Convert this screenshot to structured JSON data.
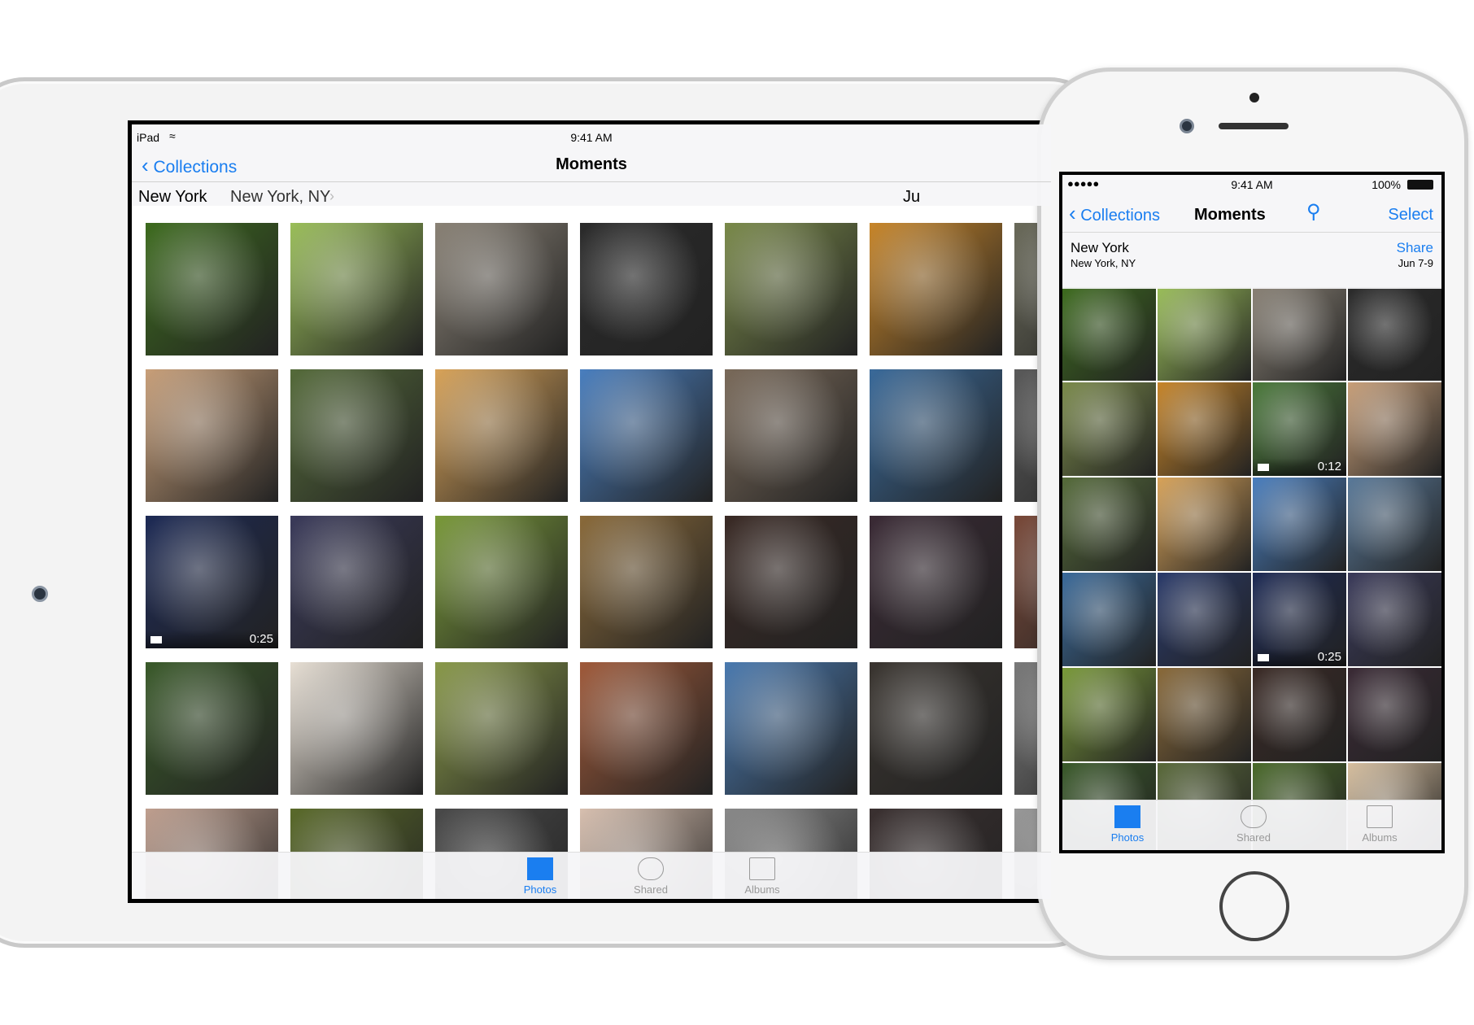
{
  "ipad": {
    "status": {
      "carrier": "iPad",
      "time": "9:41 AM"
    },
    "nav": {
      "back": "Collections",
      "title": "Moments"
    },
    "section": {
      "title": "New York",
      "location": "New York, NY",
      "date_partial": "Ju"
    },
    "photos": [
      [
        "#3d6b1e",
        "#9bbf5a",
        "#8a8276",
        "#2b2b2b",
        "#7a8a4a",
        "#c8862a",
        "#6a6a5a"
      ],
      [
        "#c9a07a",
        "#556b3a",
        "#d9a45a",
        "#4a7fbf",
        "#7a6a5a",
        "#3a6a9a",
        "#5a5a5a"
      ],
      [
        "#1d2a55",
        "#3a3a5a",
        "#7a9a3a",
        "#8a6a3a",
        "#3a2a25",
        "#3a2a35",
        "#7a4a3a"
      ],
      [
        "#3a5a2a",
        "#e8e0d5",
        "#8a9a4a",
        "#a05a3a",
        "#4a7ab0",
        "#3a3530",
        "#7a7a7a"
      ],
      [
        "#c0a090",
        "#5a6a2a",
        "#4a4a4a",
        "#d8c0b0",
        "#8a8a8a",
        "#3a3030",
        "#9a9a9a"
      ]
    ],
    "videos": [
      {
        "row": 2,
        "col": 0,
        "duration": "0:25"
      }
    ],
    "tabs": [
      {
        "label": "Photos",
        "active": true
      },
      {
        "label": "Shared",
        "active": false
      },
      {
        "label": "Albums",
        "active": false
      }
    ]
  },
  "iphone": {
    "status": {
      "signal": "●●●●●",
      "time": "9:41 AM",
      "battery": "100%"
    },
    "nav": {
      "back": "Collections",
      "title": "Moments",
      "select": "Select"
    },
    "section": {
      "title": "New York",
      "location": "New York, NY",
      "share": "Share",
      "date": "Jun 7-9"
    },
    "photos": [
      [
        "#3d6b1e",
        "#9bbf5a",
        "#8a8276",
        "#2b2b2b"
      ],
      [
        "#7a8a4a",
        "#c8862a",
        "#4a7a3a",
        "#c9a07a"
      ],
      [
        "#556b3a",
        "#d9a45a",
        "#4a7fbf",
        "#5a7a9a"
      ],
      [
        "#3a6a9a",
        "#2a3a6a",
        "#1d2a55",
        "#3a3a5a"
      ],
      [
        "#7a9a3a",
        "#8a6a3a",
        "#3a2a25",
        "#3a2a35"
      ],
      [
        "#3a5a2a",
        "#5a6a3a",
        "#4a6a2a",
        "#d8c0a0"
      ]
    ],
    "videos": [
      {
        "row": 1,
        "col": 2,
        "duration": "0:12"
      },
      {
        "row": 3,
        "col": 2,
        "duration": "0:25"
      }
    ],
    "tabs": [
      {
        "label": "Photos",
        "active": true
      },
      {
        "label": "Shared",
        "active": false
      },
      {
        "label": "Albums",
        "active": false
      }
    ]
  },
  "colors": {
    "accent": "#1a7ef0"
  }
}
